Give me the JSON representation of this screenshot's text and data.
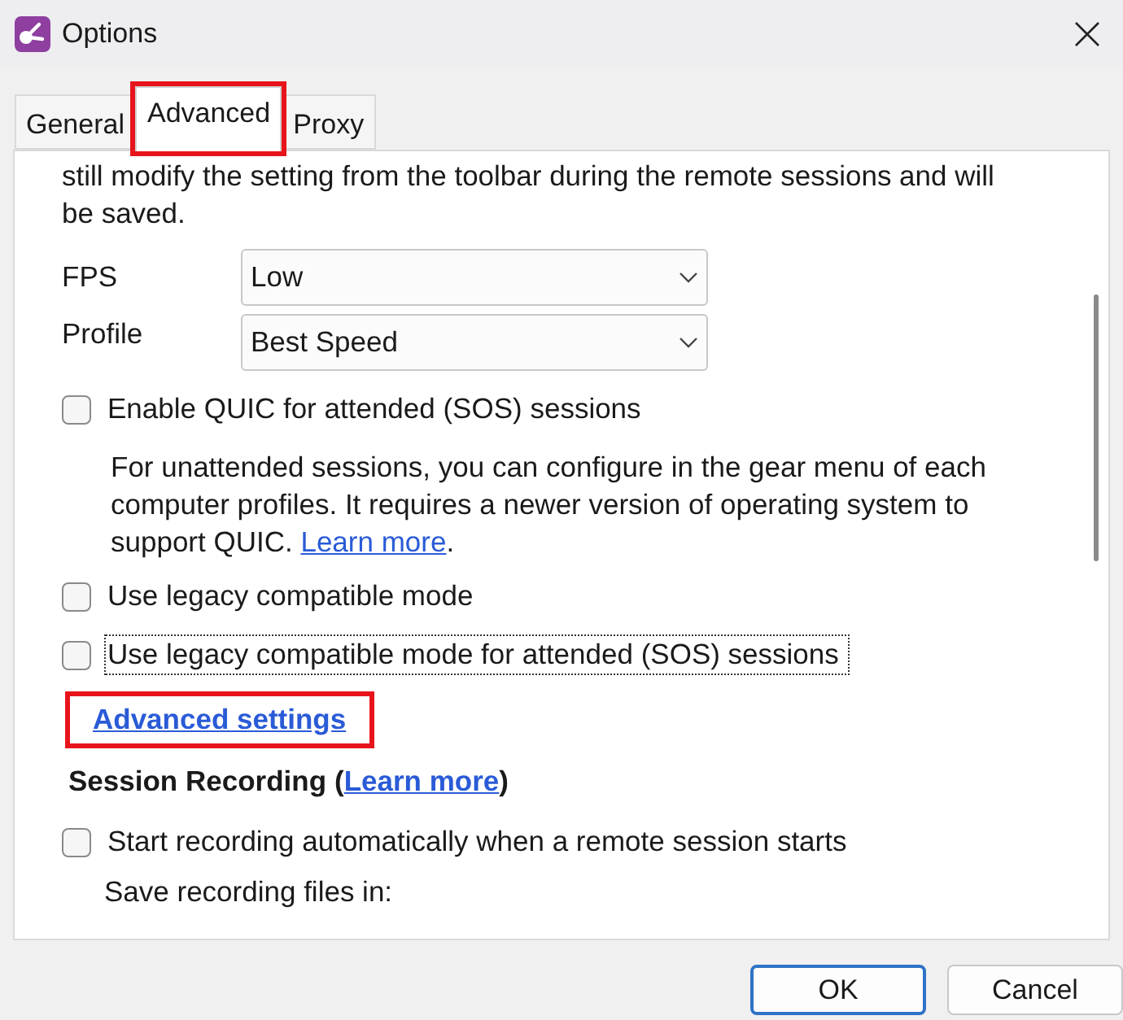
{
  "window": {
    "title": "Options"
  },
  "tabs": [
    {
      "label": "General",
      "selected": false,
      "highlighted": false
    },
    {
      "label": "Advanced",
      "selected": true,
      "highlighted": true
    },
    {
      "label": "Proxy",
      "selected": false,
      "highlighted": false
    }
  ],
  "intro": "still modify the setting from the toolbar during the remote sessions and will be saved.",
  "selects": [
    {
      "label": "FPS",
      "value": "Low"
    },
    {
      "label": "Profile",
      "value": "Best Speed"
    }
  ],
  "quic": {
    "label": "Enable QUIC for attended (SOS) sessions",
    "checked": false,
    "note": "For unattended sessions, you can configure in the gear menu of each computer profiles. It requires a newer version of operating system to support QUIC.",
    "link": "Learn more",
    "after": "."
  },
  "legacy": [
    {
      "label": "Use legacy compatible mode",
      "checked": false,
      "focused": false
    },
    {
      "label": "Use legacy compatible mode for attended (SOS) sessions",
      "checked": false,
      "focused": true
    }
  ],
  "advanced_link": {
    "label": "Advanced settings",
    "highlighted": true
  },
  "recording": {
    "heading": "Session Recording",
    "open": "(",
    "link": "Learn more",
    "close": ")",
    "checkbox": {
      "label": "Start recording automatically when a remote session starts",
      "checked": false
    },
    "save_label": "Save recording files in:"
  },
  "buttons": [
    {
      "label": "OK",
      "default": true
    },
    {
      "label": "Cancel",
      "default": false
    }
  ]
}
